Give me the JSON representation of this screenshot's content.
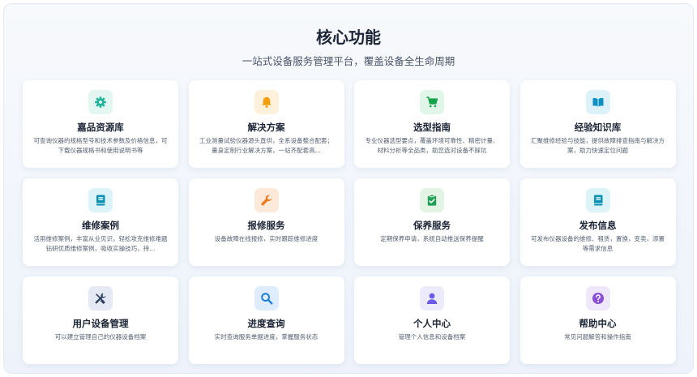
{
  "header": {
    "title": "核心功能",
    "subtitle": "一站式设备服务管理平台，覆盖设备全生命周期"
  },
  "cards": [
    {
      "icon": "gear-icon",
      "icon_color": "#1fb39a",
      "icon_bg": "#e3f6f1",
      "title": "嘉品资源库",
      "desc": "可查询仪器的规格型号和技术参数及价格信息，可下载仪器规格书和使用说明书等"
    },
    {
      "icon": "bell-icon",
      "icon_color": "#f59e0b",
      "icon_bg": "#fdf1dc",
      "title": "解决方案",
      "desc": "工业测量试验仪器源头直供，全系设备整合配套；量身定制行业解决方案，一站齐配套高..."
    },
    {
      "icon": "cart-icon",
      "icon_color": "#16a34a",
      "icon_bg": "#e1f5e8",
      "title": "选型指南",
      "desc": "专业仪器选型要点，覆盖环境可靠性、精密计量、材料分析等全品类，助您选对设备不踩坑"
    },
    {
      "icon": "book-open-icon",
      "icon_color": "#0e8fc2",
      "icon_bg": "#ddf1f8",
      "title": "经验知识库",
      "desc": "汇聚维修经验与技能，提供故障排查指南与解决方案，助力快速定位问题"
    },
    {
      "icon": "book-icon",
      "icon_color": "#0891b2",
      "icon_bg": "#dcf3f7",
      "title": "维修案例",
      "desc": "活用维修案例，丰富从业见识，轻松攻克维修难题 钻研优质维修案例，吸收实操技巧，持..."
    },
    {
      "icon": "wrench-icon",
      "icon_color": "#ea7a1d",
      "icon_bg": "#fde9d9",
      "title": "报修服务",
      "desc": "设备故障在线报修，实时跟踪维修进度"
    },
    {
      "icon": "clipboard-check-icon",
      "icon_color": "#22a055",
      "icon_bg": "#e3f4e4",
      "title": "保养服务",
      "desc": "定期保养申请，系统自动推送保养提醒"
    },
    {
      "icon": "book-icon",
      "icon_color": "#0891b2",
      "icon_bg": "#dcf3f7",
      "title": "发布信息",
      "desc": "可发布仪器设备的维修、租赁，置换，变卖，添置等需求信息"
    },
    {
      "icon": "tools-icon",
      "icon_color": "#2f3f5c",
      "icon_bg": "#e4e9f4",
      "title": "用户设备管理",
      "desc": "可以建立管理自己的仪器设备档案"
    },
    {
      "icon": "search-icon",
      "icon_color": "#1d7fd8",
      "icon_bg": "#deecfb",
      "title": "进度查询",
      "desc": "实时查询服务单据进度，掌握服务状态"
    },
    {
      "icon": "user-icon",
      "icon_color": "#6b5ce7",
      "icon_bg": "#ecebfb",
      "title": "个人中心",
      "desc": "管理个人信息和设备档案"
    },
    {
      "icon": "question-icon",
      "icon_color": "#8b4fd6",
      "icon_bg": "#efe7fa",
      "title": "帮助中心",
      "desc": "常见问题解答和操作指南"
    }
  ]
}
